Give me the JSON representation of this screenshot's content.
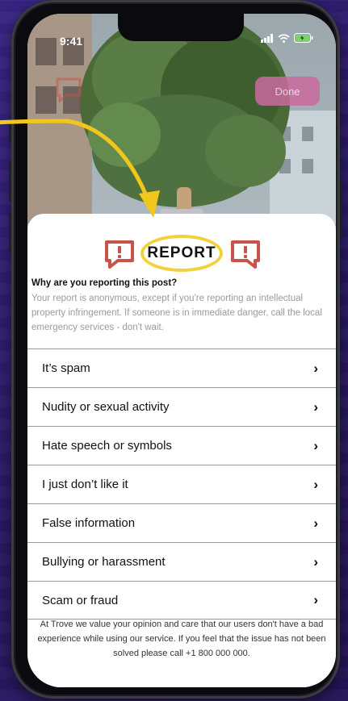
{
  "status_bar": {
    "time": "9:41"
  },
  "top_bar": {
    "done_label": "Done"
  },
  "sheet": {
    "title": "REPORT",
    "question": "Why are you reporting this post?",
    "description": "Your report is anonymous, except if you're reporting an intellectual property infringement. If someone is in immediate danger, call the local emergency services - don't wait.",
    "options": [
      {
        "label": "It’s spam"
      },
      {
        "label": "Nudity or sexual activity"
      },
      {
        "label": "Hate speech or symbols"
      },
      {
        "label": "I just don’t like it"
      },
      {
        "label": "False information"
      },
      {
        "label": "Bullying or harassment"
      },
      {
        "label": "Scam or fraud"
      }
    ],
    "chevron": "›",
    "footer": "At Trove we value your opinion and care that our users don't have a bad experience while using our service. If you feel that the issue has not been solved please call +1 800 000 000."
  },
  "colors": {
    "report_icon": "#c8534b",
    "highlight": "#f2d23c",
    "done_button": "#c96a9e",
    "background": "#2e1d6e"
  },
  "icons": [
    "report-bubble-icon",
    "signal-icon",
    "wifi-icon",
    "battery-icon",
    "chevron-right-icon"
  ]
}
